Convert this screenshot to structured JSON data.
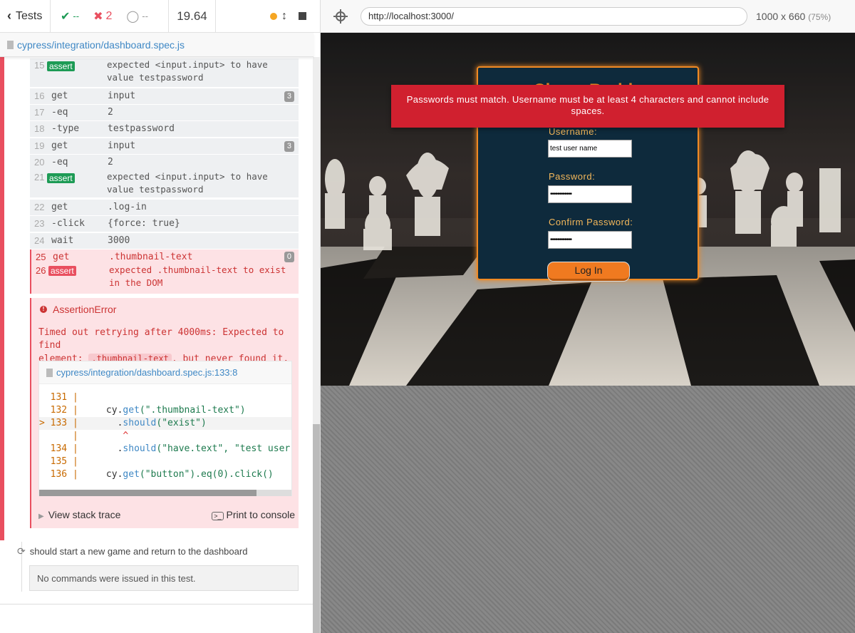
{
  "reporter": {
    "back_label": "Tests",
    "stats": {
      "passed": "--",
      "failed": "2",
      "pending": "--"
    },
    "duration": "19.64",
    "spec_path": "cypress/integration/dashboard.spec.js",
    "commands": [
      {
        "n": "15",
        "name": "assert",
        "msg_a": "expected",
        "msg_b": "<input.input>",
        "msg_c": "to have",
        "msg_d": "value",
        "msg_e": "testpassword"
      },
      {
        "n": "16",
        "name": "get",
        "msg": "input",
        "badge": "3"
      },
      {
        "n": "17",
        "name": "-eq",
        "msg": "2"
      },
      {
        "n": "18",
        "name": "-type",
        "msg": "testpassword"
      },
      {
        "n": "19",
        "name": "get",
        "msg": "input",
        "badge": "3"
      },
      {
        "n": "20",
        "name": "-eq",
        "msg": "2"
      },
      {
        "n": "21",
        "name": "assert",
        "msg_a": "expected",
        "msg_b": "<input.input>",
        "msg_c": "to have",
        "msg_d": "value",
        "msg_e": "testpassword"
      },
      {
        "n": "22",
        "name": "get",
        "msg": ".log-in"
      },
      {
        "n": "23",
        "name": "-click",
        "msg": "{force: true}"
      },
      {
        "n": "24",
        "name": "wait",
        "msg": "3000"
      },
      {
        "n": "25",
        "name": "get",
        "msg": ".thumbnail-text",
        "badge": "0"
      },
      {
        "n": "26",
        "name": "assert",
        "msg_a": "expected",
        "msg_b": ".thumbnail-text",
        "msg_c": "to exist",
        "msg_d": "in the DOM"
      }
    ],
    "error": {
      "title": "AssertionError",
      "msg_1": "Timed out retrying after 4000ms: Expected to find",
      "msg_2": "element:",
      "msg_chip": ".thumbnail-text",
      "msg_3": ", but never found it.",
      "file_link": "cypress/integration/dashboard.spec.js:133:8",
      "code": [
        {
          "ln": "  131 |",
          "text": ""
        },
        {
          "ln": "  132 |",
          "pre": "     cy.",
          "fn": "get",
          "str": "(\".thumbnail-text\")"
        },
        {
          "ln": "> 133 |",
          "pre": "       .",
          "fn": "should",
          "str": "(\"exist\")"
        },
        {
          "ln": "      |",
          "caret": "        ^"
        },
        {
          "ln": "  134 |",
          "pre": "       .",
          "fn": "should",
          "str": "(\"have.text\", \"test user"
        },
        {
          "ln": "  135 |",
          "text": ""
        },
        {
          "ln": "  136 |",
          "pre": "     cy.",
          "fn": "get",
          "str": "(\"button\").eq(0).click()"
        }
      ],
      "view_stack": "View stack trace",
      "print_console": "Print to console"
    },
    "test2_title": "should start a new game and return to the dashboard",
    "no_commands": "No commands were issued in this test."
  },
  "preview": {
    "url": "http://localhost:3000/",
    "size": "1000 x 660",
    "scale": "(75%)"
  },
  "app": {
    "title": "Chess Buddy",
    "error": "Passwords must match. Username must be at least 4 characters and cannot include spaces.",
    "username_label": "Username:",
    "username_value": "test user name",
    "password_label": "Password:",
    "password_value": "••••••••••••",
    "confirm_label": "Confirm Password:",
    "confirm_value": "••••••••••••",
    "login_label": "Log In"
  }
}
